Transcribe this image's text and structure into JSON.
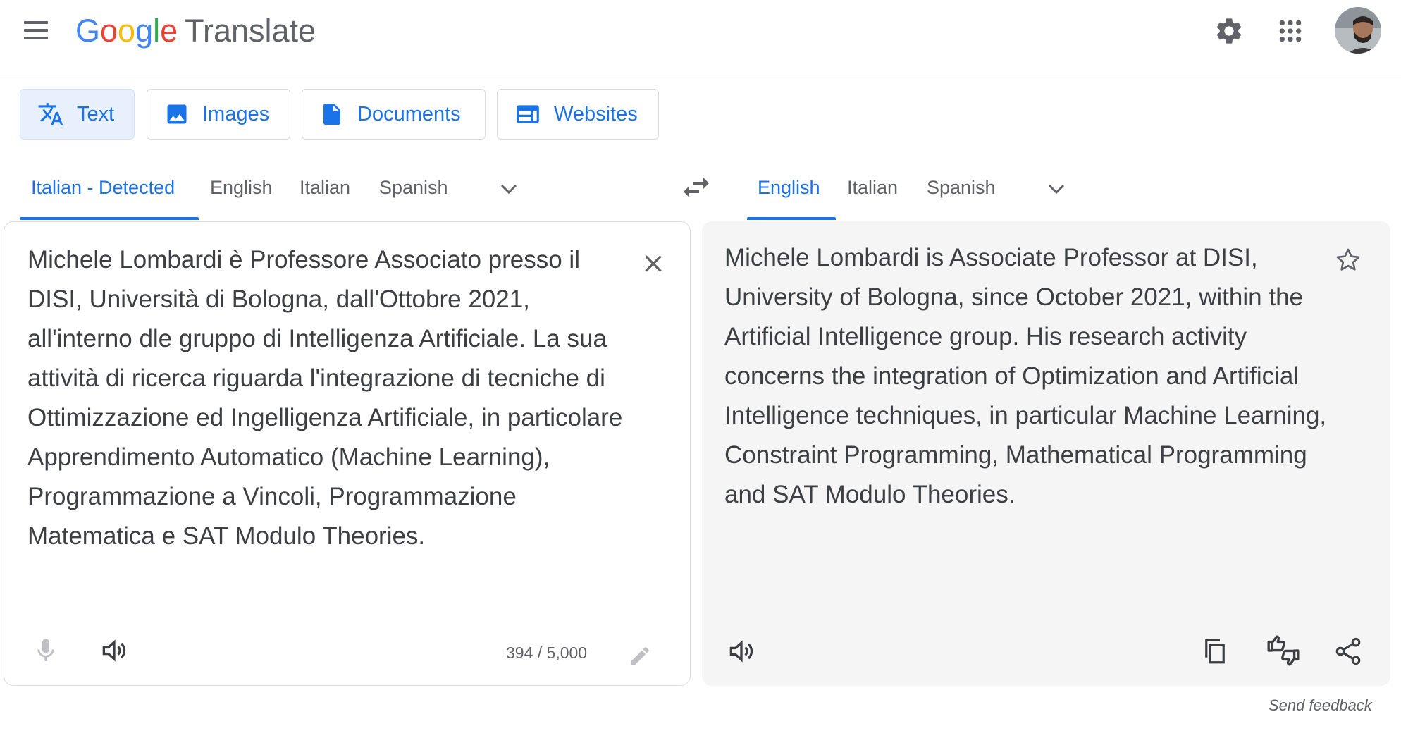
{
  "header": {
    "logo_google": [
      "G",
      "o",
      "o",
      "g",
      "l",
      "e"
    ],
    "product_name": "Translate",
    "settings_icon": "gear-icon",
    "apps_icon": "apps-grid-icon"
  },
  "modes": [
    {
      "label": "Text",
      "icon": "translate-icon",
      "active": true
    },
    {
      "label": "Images",
      "icon": "image-icon",
      "active": false
    },
    {
      "label": "Documents",
      "icon": "document-icon",
      "active": false
    },
    {
      "label": "Websites",
      "icon": "website-icon",
      "active": false
    }
  ],
  "source_langs": [
    "Italian - Detected",
    "English",
    "Italian",
    "Spanish"
  ],
  "target_langs": [
    "English",
    "Italian",
    "Spanish"
  ],
  "source": {
    "text": "Michele Lombardi è Professore Associato presso il DISI, Università di Bologna, dall'Ottobre 2021, all'interno dle gruppo di Intelligenza Artificiale. La sua attività di ricerca riguarda l'integrazione di tecniche di Ottimizzazione ed Ingelligenza Artificiale, in particolare Apprendimento Automatico (Machine Learning), Programmazione a Vincoli, Programmazione Matematica e SAT Modulo Theories.",
    "char_count": "394 / 5,000"
  },
  "target": {
    "text": "Michele Lombardi is Associate Professor at DISI, University of Bologna, since October 2021, within the Artificial Intelligence group. His research activity concerns the integration of Optimization and Artificial Intelligence techniques, in particular Machine Learning, Constraint Programming, Mathematical Programming and SAT Modulo Theories."
  },
  "feedback_label": "Send feedback",
  "colors": {
    "accent": "#1a73e8",
    "tab_active_bg": "#e8f0fe",
    "target_bg": "#f5f5f5"
  }
}
